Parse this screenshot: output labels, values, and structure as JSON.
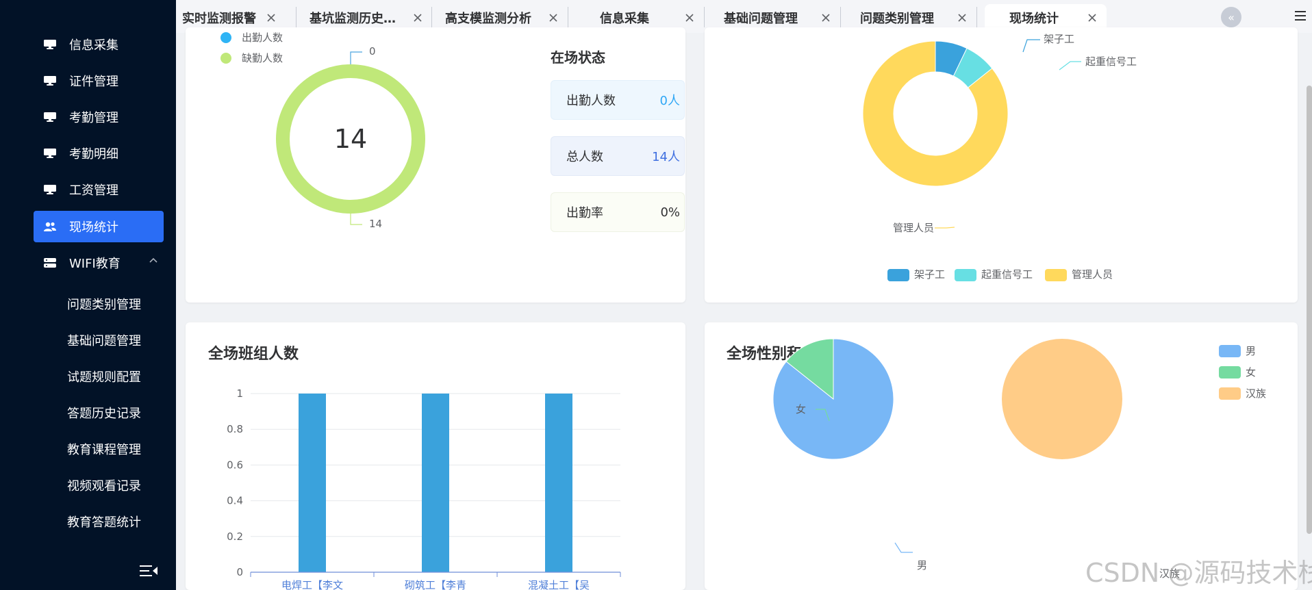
{
  "sidebar": {
    "items": [
      {
        "label": "信息采集",
        "icon": "monitor-icon"
      },
      {
        "label": "证件管理",
        "icon": "monitor-icon"
      },
      {
        "label": "考勤管理",
        "icon": "monitor-icon"
      },
      {
        "label": "考勤明细",
        "icon": "monitor-icon"
      },
      {
        "label": "工资管理",
        "icon": "monitor-icon"
      },
      {
        "label": "现场统计",
        "icon": "users-icon"
      },
      {
        "label": "WIFI教育",
        "icon": "server-icon"
      }
    ],
    "subitems": [
      {
        "label": "问题类别管理"
      },
      {
        "label": "基础问题管理"
      },
      {
        "label": "试题规则配置"
      },
      {
        "label": "答题历史记录"
      },
      {
        "label": "教育课程管理"
      },
      {
        "label": "视频观看记录"
      },
      {
        "label": "教育答题统计"
      }
    ]
  },
  "tabs": [
    {
      "label": "实时监测报警"
    },
    {
      "label": "基坑监测历史…"
    },
    {
      "label": "高支模监测分析"
    },
    {
      "label": "信息采集"
    },
    {
      "label": "基础问题管理"
    },
    {
      "label": "问题类别管理"
    },
    {
      "label": "现场统计"
    }
  ],
  "tab_prev_symbol": "«",
  "attendance": {
    "legend": [
      "出勤人数",
      "缺勤人数"
    ],
    "center_value": "14",
    "label_top": "0",
    "label_bottom": "14",
    "status_title": "在场状态",
    "boxes": [
      {
        "label": "出勤人数",
        "value": "0人",
        "color": "#2fa7f5",
        "bg": "#eef7fe"
      },
      {
        "label": "总人数",
        "value": "14人",
        "color": "#3f6fe0",
        "bg": "#eef3fc"
      },
      {
        "label": "出勤率",
        "value": "0%",
        "color": "#303133",
        "bg": "#fbfdf6"
      }
    ]
  },
  "job_donut": {
    "labels": {
      "a": "架子工",
      "b": "起重信号工",
      "c": "管理人员"
    },
    "legend": [
      "架子工",
      "起重信号工",
      "管理人员"
    ]
  },
  "team_chart": {
    "title": "全场班组人数",
    "ticks": [
      "0",
      "0.2",
      "0.4",
      "0.6",
      "0.8",
      "1"
    ],
    "xlabels": [
      "电焊工【李文",
      "砌筑工【李青",
      "混凝土工【吴"
    ]
  },
  "gender_chart": {
    "title": "全场性别和民族",
    "legend": [
      "男",
      "女",
      "汉族"
    ],
    "pie_labels": {
      "female": "女",
      "male": "男",
      "han": "汉族"
    }
  },
  "watermark": "CSDN @源码技术栈",
  "chart_data": [
    {
      "type": "pie",
      "labels": [
        "出勤人数",
        "缺勤人数"
      ],
      "values": [
        0,
        14
      ],
      "colors": [
        "#2fb4f5",
        "#c0e879"
      ]
    },
    {
      "type": "pie",
      "labels": [
        "架子工",
        "起重信号工",
        "管理人员"
      ],
      "values": [
        1,
        1,
        12
      ],
      "colors": [
        "#3aa2dc",
        "#67dfe3",
        "#ffd95c"
      ]
    },
    {
      "type": "bar",
      "categories": [
        "电焊工【李文",
        "砌筑工【李青",
        "混凝土工【吴"
      ],
      "values": [
        1,
        1,
        1
      ],
      "ylim": [
        0,
        1
      ],
      "color": "#3aa2dc"
    },
    {
      "type": "pie",
      "labels": [
        "男",
        "女"
      ],
      "values": [
        12,
        2
      ],
      "colors": [
        "#78b7f6",
        "#75dba0"
      ]
    },
    {
      "type": "pie",
      "labels": [
        "汉族"
      ],
      "values": [
        14
      ],
      "colors": [
        "#ffcc87"
      ]
    }
  ]
}
